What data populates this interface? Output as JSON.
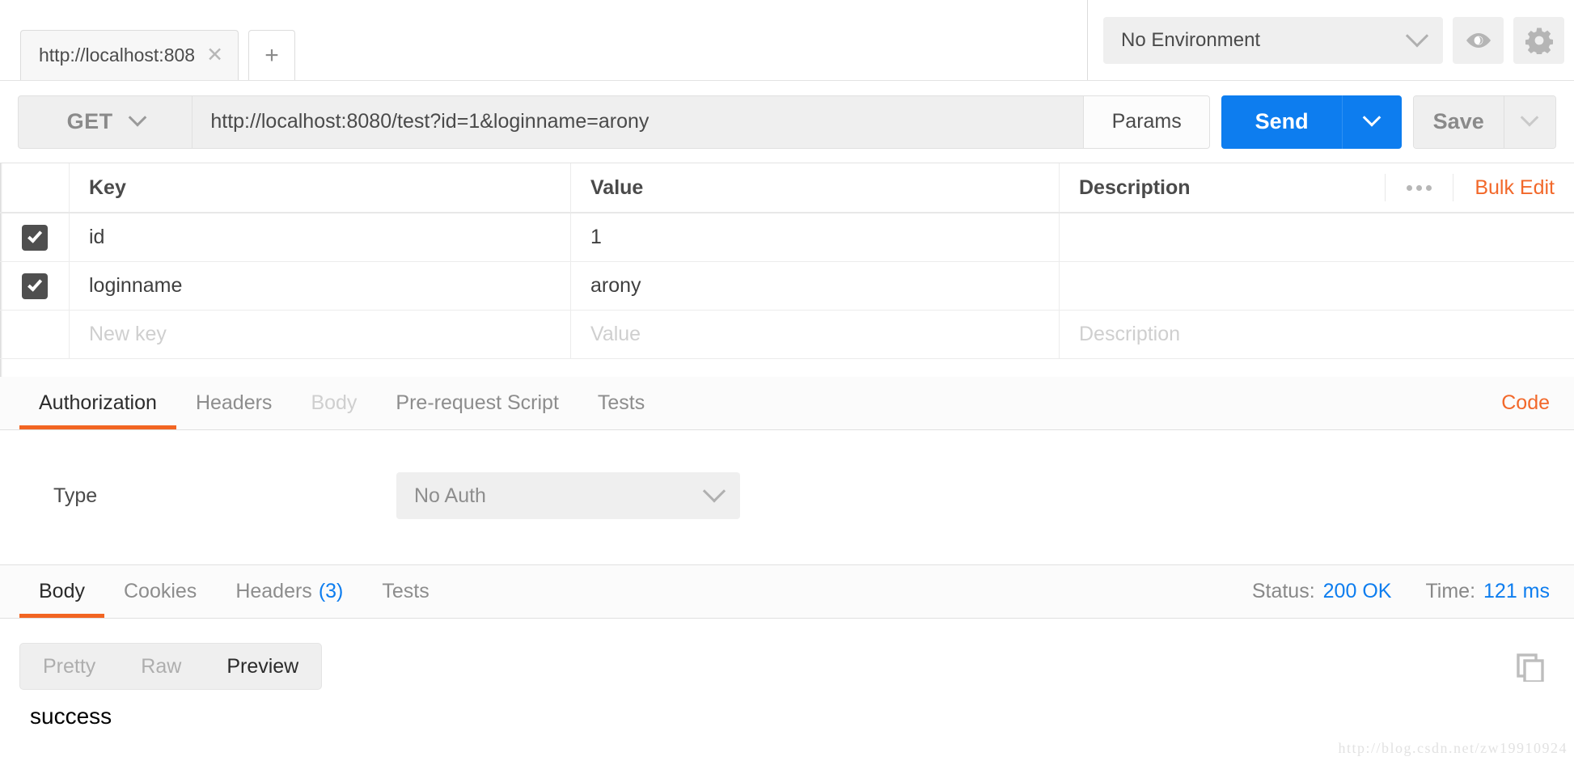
{
  "window": {
    "app": "Postman"
  },
  "tabstrip": {
    "tabs": [
      {
        "title": "http://localhost:808",
        "close_icon": "close-icon"
      }
    ],
    "add_label": "+"
  },
  "environment": {
    "selected": "No Environment",
    "chevron_icon": "chevron-down-icon",
    "eye_icon": "eye-icon",
    "gear_icon": "gear-icon"
  },
  "request": {
    "method": "GET",
    "url": "http://localhost:8080/test?id=1&loginname=arony",
    "params_label": "Params",
    "send_label": "Send",
    "save_label": "Save"
  },
  "params": {
    "headers": {
      "key": "Key",
      "value": "Value",
      "description": "Description"
    },
    "bulk_edit_label": "Bulk Edit",
    "more_icon": "ellipsis-icon",
    "rows": [
      {
        "checked": true,
        "key": "id",
        "value": "1",
        "description": ""
      },
      {
        "checked": true,
        "key": "loginname",
        "value": "arony",
        "description": ""
      }
    ],
    "new_row": {
      "key_placeholder": "New key",
      "value_placeholder": "Value",
      "description_placeholder": "Description"
    }
  },
  "request_tabs": {
    "items": [
      {
        "label": "Authorization",
        "state": "active"
      },
      {
        "label": "Headers",
        "state": "normal"
      },
      {
        "label": "Body",
        "state": "disabled"
      },
      {
        "label": "Pre-request Script",
        "state": "normal"
      },
      {
        "label": "Tests",
        "state": "normal"
      }
    ],
    "code_label": "Code"
  },
  "auth": {
    "type_label": "Type",
    "type_value": "No Auth"
  },
  "response_tabs": {
    "items": [
      {
        "label": "Body",
        "count": "",
        "state": "active"
      },
      {
        "label": "Cookies",
        "count": "",
        "state": "normal"
      },
      {
        "label": "Headers",
        "count": "(3)",
        "state": "normal"
      },
      {
        "label": "Tests",
        "count": "",
        "state": "normal"
      }
    ],
    "status_label": "Status:",
    "status_value": "200 OK",
    "time_label": "Time:",
    "time_value": "121 ms"
  },
  "response_body": {
    "views": [
      {
        "label": "Pretty",
        "state": "normal"
      },
      {
        "label": "Raw",
        "state": "normal"
      },
      {
        "label": "Preview",
        "state": "active"
      }
    ],
    "copy_icon": "copy-icon",
    "content": "success"
  },
  "watermark": {
    "text": "http://blog.csdn.net/zw19910924"
  },
  "colors": {
    "accent_blue": "#0d7def",
    "accent_orange": "#f26522",
    "link_orange": "#f2682a",
    "panel_gray": "#efefef",
    "border_gray": "#e0e0e0"
  }
}
